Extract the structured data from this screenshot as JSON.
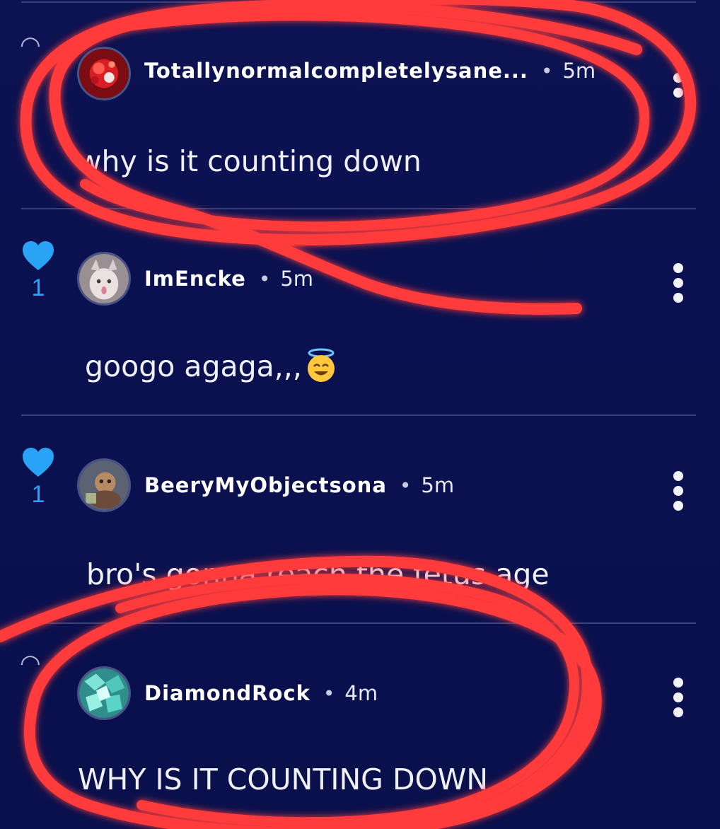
{
  "colors": {
    "background": "#0b1150",
    "divider": "#3a4178",
    "like_blue": "#29a3f5",
    "annotation_red": "#ff3b3b"
  },
  "comments": [
    {
      "username": "Totallynormalcompletelysane...",
      "separator": "•",
      "time": "5m",
      "text": "why is it counting down",
      "avatar_icon": "red-flower-avatar-icon",
      "like_count": "",
      "liked": false
    },
    {
      "username": "ImEncke",
      "separator": "•",
      "time": "5m",
      "text": "googo agaga,,,",
      "emoji": "smiling-face-with-halo-emoji",
      "avatar_icon": "cat-avatar-icon",
      "like_count": "1",
      "liked": true
    },
    {
      "username": "BeeryMyObjectsona",
      "separator": "•",
      "time": "5m",
      "text": "bro's gonna reach the fetus age",
      "avatar_icon": "painting-avatar-icon",
      "like_count": "1",
      "liked": true
    },
    {
      "username": "DiamondRock",
      "separator": "•",
      "time": "4m",
      "text": "WHY IS IT COUNTING DOWN",
      "avatar_icon": "diamond-avatar-icon",
      "like_count": "",
      "liked": false
    }
  ],
  "icons": {
    "like": "heart-icon",
    "more": "more-vertical-icon"
  }
}
